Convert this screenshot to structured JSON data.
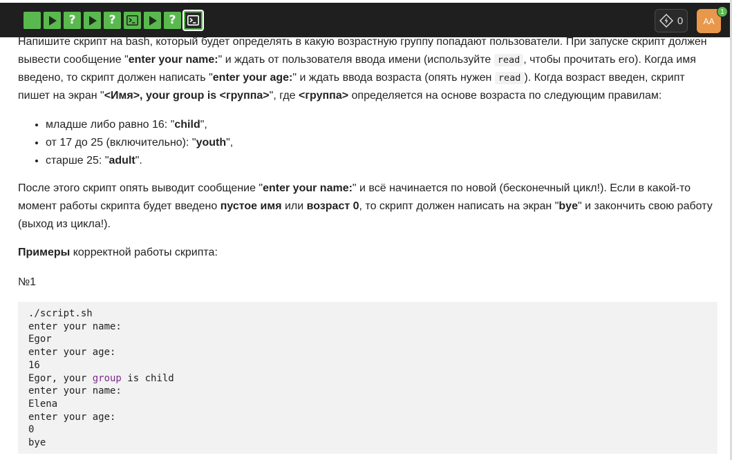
{
  "toolbar": {
    "steps": [
      {
        "kind": "empty",
        "state": "done"
      },
      {
        "kind": "play-icon",
        "state": "done"
      },
      {
        "kind": "question-icon",
        "state": "done",
        "glyph": "?"
      },
      {
        "kind": "play-icon",
        "state": "done"
      },
      {
        "kind": "question-icon",
        "state": "done",
        "glyph": "?"
      },
      {
        "kind": "terminal-icon",
        "state": "done"
      },
      {
        "kind": "play-icon",
        "state": "done"
      },
      {
        "kind": "question-icon",
        "state": "done",
        "glyph": "?"
      },
      {
        "kind": "terminal-icon",
        "state": "current"
      }
    ],
    "energy_count": "0",
    "avatar_initials": "AA",
    "notification_count": "1",
    "accent_color": "#5ab94e",
    "avatar_color": "#e9974a"
  },
  "task": {
    "p1": {
      "t1": "Напишите скрипт на bash, который будет определять в какую возрастную группу попадают пользователи. При запуске скрипт должен вывести сообщение \"",
      "b1": "enter your name:",
      "t2": "\" и ждать от пользователя ввода имени (используйте ",
      "c1": "read",
      "t3": ", чтобы прочитать его). Когда имя введено, то скрипт должен написать \"",
      "b2": "enter your age:",
      "t4": "\" и ждать ввода возраста (опять нужен ",
      "c2": "read",
      "t5": "). Когда возраст введен, скрипт пишет на экран \"",
      "b3": "<Имя>, your group is <группа>",
      "t6": "\", где ",
      "b4": "<группа>",
      "t7": " определяется на основе возраста по следующим правилам:"
    },
    "rules": [
      {
        "text": "младше либо равно 16: \"",
        "bold": "child",
        "end": "\","
      },
      {
        "text": "от 17 до 25 (включительно): \"",
        "bold": "youth",
        "end": "\","
      },
      {
        "text": "старше 25: \"",
        "bold": "adult",
        "end": "\"."
      }
    ],
    "p2": {
      "t1": "После этого скрипт опять выводит сообщение \"",
      "b1": "enter your name:",
      "t2": "\" и всё начинается по новой (бесконечный цикл!). Если в какой-то момент работы скрипта будет введено ",
      "b2": "пустое имя",
      "t3": " или ",
      "b3": "возраст 0",
      "t4": ", то скрипт должен написать на экран \"",
      "b4": "bye",
      "t5": "\" и закончить свою работу (выход из цикла!)."
    },
    "p3": {
      "b1": "Примеры",
      "t1": " корректной работы скрипта:"
    },
    "p4": "№1",
    "code": {
      "l1": "./script.sh",
      "l2": "enter your name:",
      "l3": "Egor",
      "l4": "enter your age:",
      "l5": "16",
      "l6a": "Egor, your ",
      "l6b": "group",
      "l6c": " is child",
      "l7": "enter your name:",
      "l8": "Elena",
      "l9": "enter your age:",
      "l10": "0",
      "l11": "bye"
    }
  }
}
